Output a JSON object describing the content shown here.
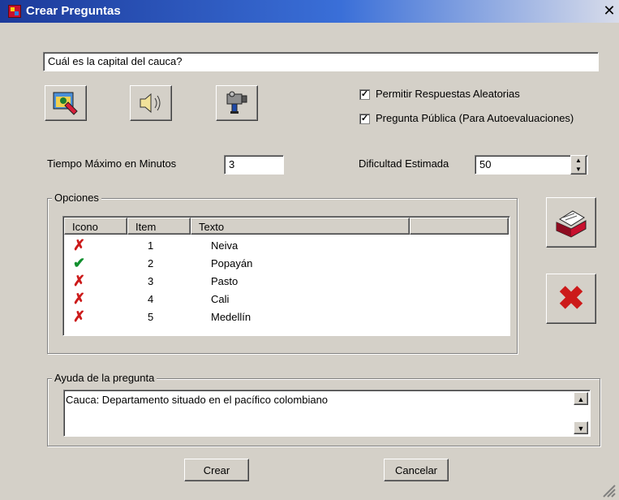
{
  "window": {
    "title": "Crear Preguntas",
    "close_glyph": "✕"
  },
  "question": {
    "value": "Cuál es la capital del cauca?"
  },
  "toolbar_icons": [
    {
      "name": "image-editor-icon",
      "glyph": "🖼"
    },
    {
      "name": "speaker-icon",
      "glyph": "🔊"
    },
    {
      "name": "video-camera-icon",
      "glyph": "🎥"
    }
  ],
  "options_checkboxes": [
    {
      "label": "Permitir Respuestas Aleatorias",
      "checked": true
    },
    {
      "label": "Pregunta Pública (Para Autoevaluaciones)",
      "checked": true
    }
  ],
  "time": {
    "label": "Tiempo Máximo en Minutos",
    "value": "3"
  },
  "difficulty": {
    "label": "Dificultad Estimada",
    "value": "50"
  },
  "options_group": {
    "title": "Opciones",
    "columns": [
      "Icono",
      "Item",
      "Texto"
    ],
    "rows": [
      {
        "icon": "cross",
        "item": "1",
        "text": "Neiva"
      },
      {
        "icon": "check",
        "item": "2",
        "text": "Popayán"
      },
      {
        "icon": "cross",
        "item": "3",
        "text": "Pasto"
      },
      {
        "icon": "cross",
        "item": "4",
        "text": "Cali"
      },
      {
        "icon": "cross",
        "item": "5",
        "text": "Medellín"
      }
    ]
  },
  "side_buttons": {
    "add_icon": "printer-card-icon",
    "delete_icon": "red-x-icon",
    "delete_glyph": "✖"
  },
  "help_group": {
    "title": "Ayuda de la pregunta",
    "value": "Cauca: Departamento situado en el pacífico colombiano"
  },
  "footer": {
    "create_label": "Crear",
    "cancel_label": "Cancelar"
  },
  "colors": {
    "title_bar_start": "#1c3a9a",
    "title_bar_end": "#d8dcea",
    "window_bg": "#d4d0c8",
    "cross": "#cc1a1a",
    "check": "#118f2e"
  }
}
